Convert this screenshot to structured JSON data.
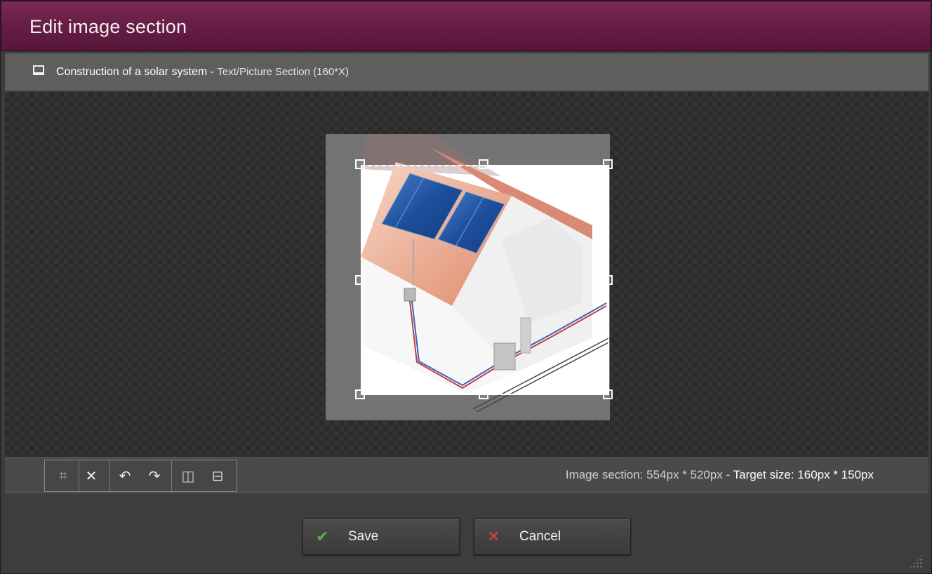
{
  "dialog": {
    "title": "Edit image section"
  },
  "subheader": {
    "doc_name": "Construction of a solar system",
    "separator": " - ",
    "section_type": "Text/Picture Section (160*X)"
  },
  "toolbar": {
    "tools": [
      {
        "name": "crop-icon",
        "glyph": "⌗"
      },
      {
        "name": "close-icon",
        "glyph": "✕"
      },
      {
        "name": "undo-icon",
        "glyph": "↶"
      },
      {
        "name": "redo-icon",
        "glyph": "↷"
      },
      {
        "name": "flip-horizontal-icon",
        "glyph": "⧉"
      },
      {
        "name": "flip-vertical-icon",
        "glyph": "⊟"
      }
    ],
    "section_info": "Image section: 554px * 520px",
    "info_sep": " - ",
    "target_info": "Target size: 160px * 150px"
  },
  "footer": {
    "save_label": "Save",
    "cancel_label": "Cancel"
  },
  "colors": {
    "title_bar": "#6a1f48",
    "save_check": "#5fb043",
    "cancel_x": "#d04848"
  }
}
